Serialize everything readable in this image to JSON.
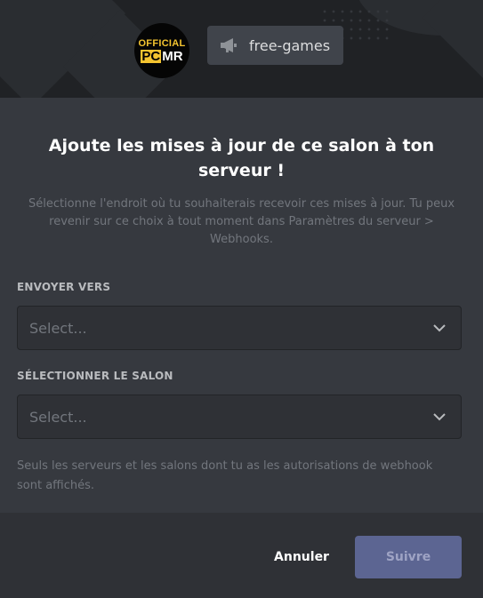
{
  "header": {
    "avatar": {
      "line1": "OFFICIAL",
      "line2_a": "PC",
      "line2_b": "MR"
    },
    "channel": {
      "name": "free-games",
      "icon": "megaphone-icon"
    }
  },
  "modal": {
    "title": "Ajoute les mises à jour de ce salon à ton serveur !",
    "subtitle": "Sélectionne l'endroit où tu souhaiterais recevoir ces mises à jour. Tu peux revenir sur ce choix à tout moment dans Paramètres du serveur > Webhooks.",
    "send_to": {
      "label": "ENVOYER VERS",
      "placeholder": "Select..."
    },
    "channel_select": {
      "label": "SÉLECTIONNER LE SALON",
      "placeholder": "Select..."
    },
    "note": "Seuls les serveurs et les salons dont tu as les autorisations de webhook sont affichés."
  },
  "footer": {
    "cancel_label": "Annuler",
    "next_label": "Suivre"
  },
  "colors": {
    "accent": "#5c6592",
    "background": "#36393f",
    "footer": "#2f3136",
    "header": "#202225"
  }
}
